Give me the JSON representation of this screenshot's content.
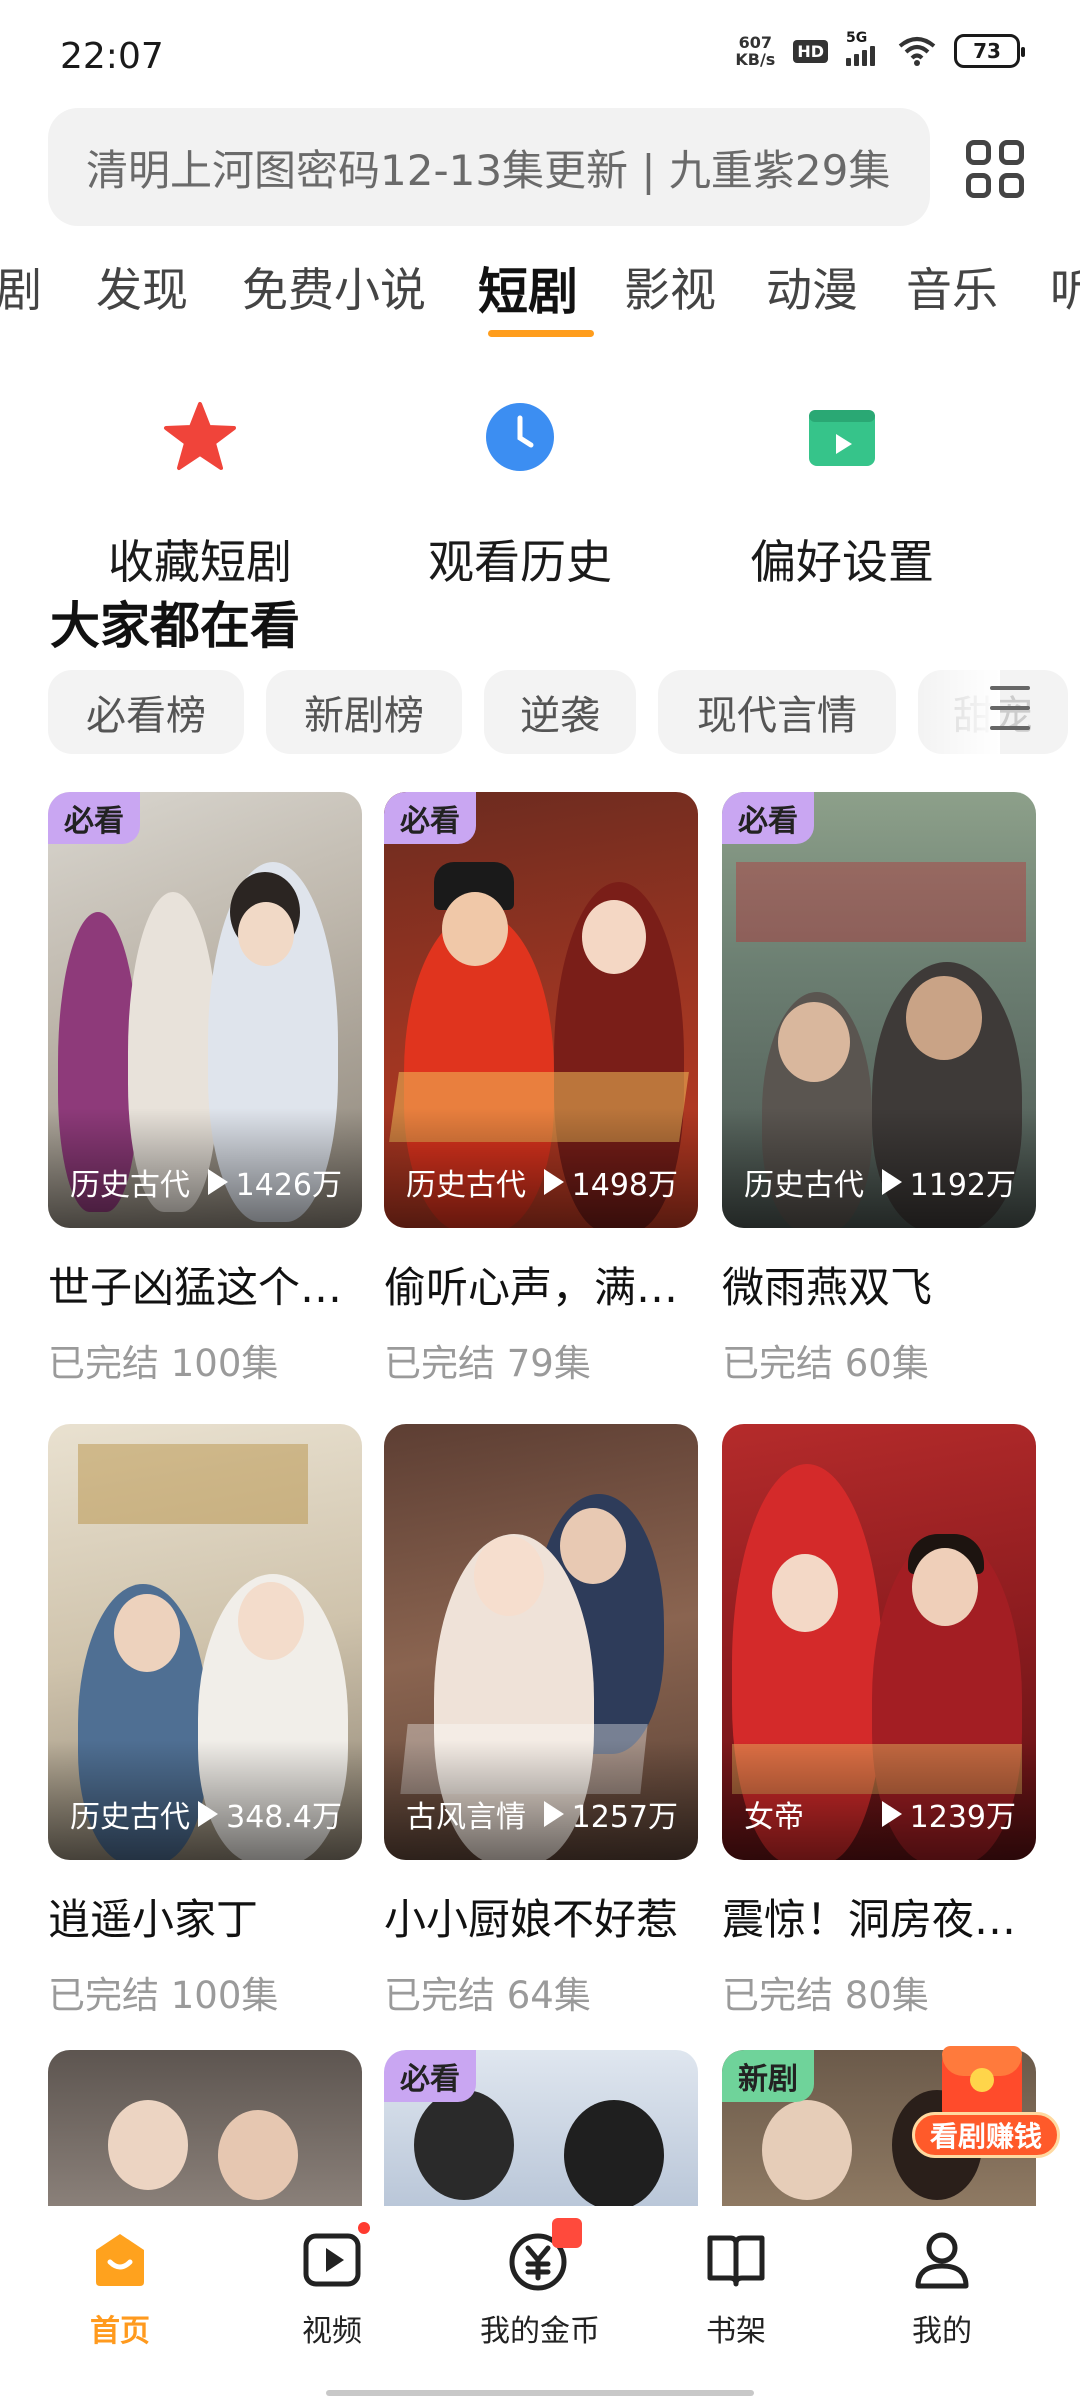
{
  "status_bar": {
    "time": "22:07",
    "net_speed_value": "607",
    "net_speed_unit": "KB/s",
    "hd_label": "HD",
    "network_label": "5G",
    "battery": "73"
  },
  "search": {
    "text": "清明上河图密码12-13集更新 | 九重紫29集"
  },
  "category_tabs": [
    "剧",
    "发现",
    "免费小说",
    "短剧",
    "影视",
    "动漫",
    "音乐",
    "听"
  ],
  "active_tab": "短剧",
  "quick_actions": [
    {
      "label": "收藏短剧",
      "icon": "star-icon",
      "color": "#f0443a"
    },
    {
      "label": "观看历史",
      "icon": "clock-icon",
      "color": "#3c8ef2"
    },
    {
      "label": "偏好设置",
      "icon": "play-card-icon",
      "color": "#36c48a"
    }
  ],
  "section_title": "大家都在看",
  "chips": [
    "必看榜",
    "新剧榜",
    "逆袭",
    "现代言情",
    "甜宠"
  ],
  "cards": [
    {
      "tag": "必看",
      "genre": "历史古代",
      "plays": "1426万",
      "title": "世子凶猛这个…",
      "status": "已完结",
      "episodes": "100集"
    },
    {
      "tag": "必看",
      "genre": "历史古代",
      "plays": "1498万",
      "title": "偷听心声，满…",
      "status": "已完结",
      "episodes": "79集"
    },
    {
      "tag": "必看",
      "genre": "历史古代",
      "plays": "1192万",
      "title": "微雨燕双飞",
      "status": "已完结",
      "episodes": "60集"
    },
    {
      "tag": "",
      "genre": "历史古代",
      "plays": "348.4万",
      "title": "逍遥小家丁",
      "status": "已完结",
      "episodes": "100集"
    },
    {
      "tag": "",
      "genre": "古风言情",
      "plays": "1257万",
      "title": "小小厨娘不好惹",
      "status": "已完结",
      "episodes": "64集"
    },
    {
      "tag": "",
      "genre": "女帝",
      "plays": "1239万",
      "title": "震惊！洞房夜…",
      "status": "已完结",
      "episodes": "80集"
    }
  ],
  "partial_tags": [
    "必看",
    "新剧"
  ],
  "reward_label": "看剧赚钱",
  "bottom_nav": [
    {
      "label": "首页",
      "icon": "home-icon"
    },
    {
      "label": "视频",
      "icon": "video-play-icon"
    },
    {
      "label": "我的金币",
      "icon": "coin-icon"
    },
    {
      "label": "书架",
      "icon": "book-icon"
    },
    {
      "label": "我的",
      "icon": "person-icon"
    }
  ],
  "colors": {
    "accent": "#ff9d1c",
    "tag_purple": "#c9a6f2",
    "tag_green": "#6fd39a"
  }
}
